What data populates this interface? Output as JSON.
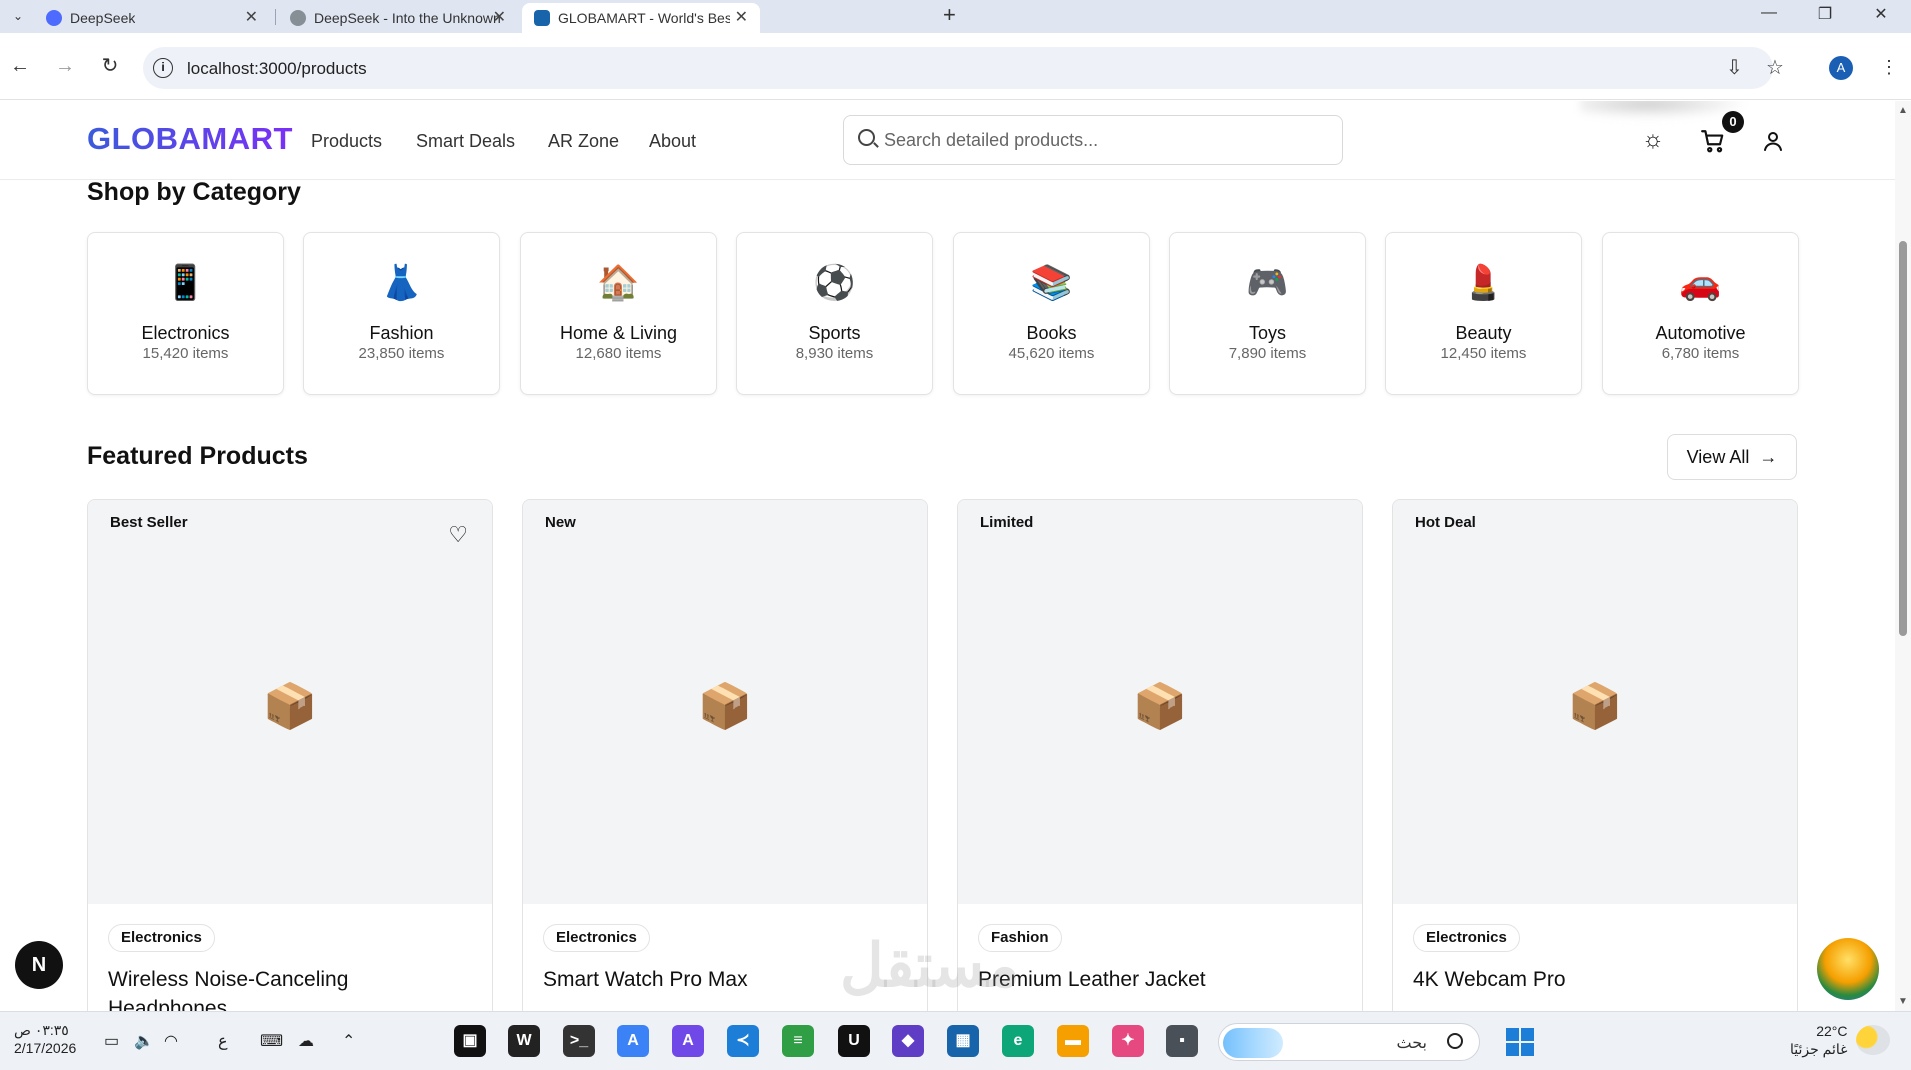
{
  "browser": {
    "tabs": [
      {
        "label": "DeepSeek",
        "active": false
      },
      {
        "label": "DeepSeek - Into the Unknown",
        "active": false
      },
      {
        "label": "GLOBAMART - World's Best Ma",
        "active": true
      }
    ],
    "url": "localhost:3000/products",
    "profile_initial": "A"
  },
  "site": {
    "logo": "GLOBAMART",
    "nav": [
      "Products",
      "Smart Deals",
      "AR Zone",
      "About"
    ],
    "search_placeholder": "Search detailed products...",
    "cart_count": "0"
  },
  "categories": {
    "title": "Shop by Category",
    "items": [
      {
        "icon": "📱",
        "icon_name": "phone-icon",
        "name": "Electronics",
        "count": "15,420 items"
      },
      {
        "icon": "👗",
        "icon_name": "dress-icon",
        "name": "Fashion",
        "count": "23,850 items"
      },
      {
        "icon": "🏠",
        "icon_name": "house-icon",
        "name": "Home & Living",
        "count": "12,680 items"
      },
      {
        "icon": "⚽",
        "icon_name": "soccer-ball-icon",
        "name": "Sports",
        "count": "8,930 items"
      },
      {
        "icon": "📚",
        "icon_name": "books-icon",
        "name": "Books",
        "count": "45,620 items"
      },
      {
        "icon": "🎮",
        "icon_name": "game-controller-icon",
        "name": "Toys",
        "count": "7,890 items"
      },
      {
        "icon": "💄",
        "icon_name": "lipstick-icon",
        "name": "Beauty",
        "count": "12,450 items"
      },
      {
        "icon": "🚗",
        "icon_name": "car-icon",
        "name": "Automotive",
        "count": "6,780 items"
      }
    ]
  },
  "featured": {
    "title": "Featured Products",
    "view_all_label": "View All",
    "products": [
      {
        "badge": "Best Seller",
        "category": "Electronics",
        "name": "Wireless Noise-Canceling Headphones",
        "show_favorite": true
      },
      {
        "badge": "New",
        "category": "Electronics",
        "name": "Smart Watch Pro Max",
        "show_favorite": false
      },
      {
        "badge": "Limited",
        "category": "Fashion",
        "name": "Premium Leather Jacket",
        "show_favorite": false
      },
      {
        "badge": "Hot Deal",
        "category": "Electronics",
        "name": "4K Webcam Pro",
        "show_favorite": false
      }
    ]
  },
  "overlays": {
    "next_badge": "N",
    "watermark": "مستقل"
  },
  "taskbar": {
    "time": "٠٣:٣٥ ص",
    "date": "2/17/2026",
    "keyboard_lang": "ع",
    "search_text": "بحث",
    "temperature": "22°C",
    "weather_desc": "غائم جزئيًا"
  }
}
